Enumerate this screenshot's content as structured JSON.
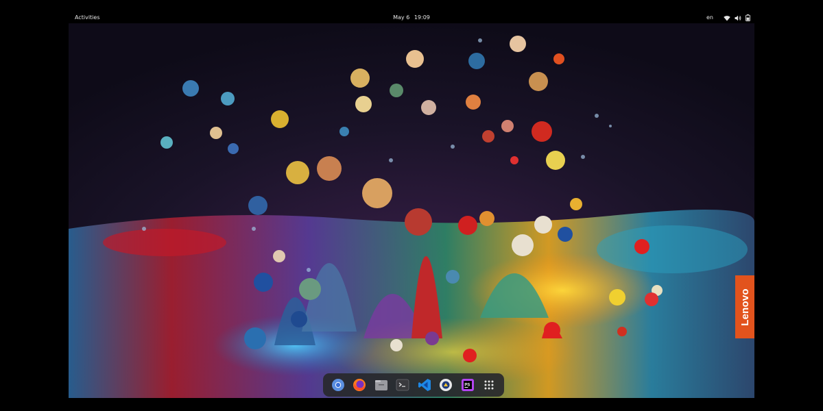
{
  "topbar": {
    "activities": "Activities",
    "date": "May 6",
    "time": "19:09",
    "language": "en",
    "icons": [
      "wifi-icon",
      "volume-icon",
      "battery-icon"
    ]
  },
  "wallpaper": {
    "description_color_bg": "#13101f",
    "brand_badge": "Lenovo",
    "brand_color": "#e2531d"
  },
  "dock": {
    "apps": [
      "chromium",
      "firefox",
      "files",
      "terminal",
      "vscode",
      "mullvad-browser",
      "phpstorm",
      "show-applications"
    ]
  }
}
